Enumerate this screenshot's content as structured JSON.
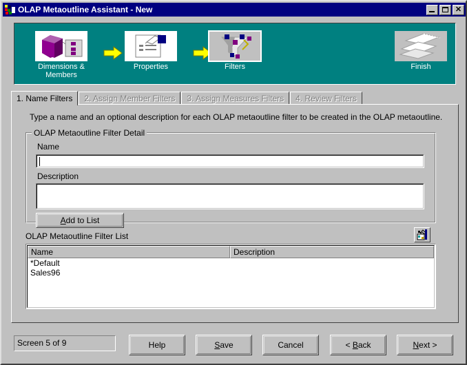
{
  "window": {
    "title": "OLAP Metaoutline Assistant - New",
    "icon": "olap-nodes-icon",
    "controls": [
      {
        "name": "minimize",
        "glyph": "_"
      },
      {
        "name": "maximize",
        "glyph": "□"
      },
      {
        "name": "close",
        "glyph": "✕"
      }
    ]
  },
  "banner": {
    "background_color": "#008080",
    "stages": [
      {
        "label": "Dimensions &\nMembers",
        "label_line1": "Dimensions &",
        "label_line2": "Members",
        "icon": "purple-cube-icon",
        "selected": false
      },
      {
        "label": "Properties",
        "label_line1": "Properties",
        "label_line2": "",
        "icon": "hand-writing-document-icon",
        "selected": false
      },
      {
        "label": "Filters",
        "label_line1": "Filters",
        "label_line2": "",
        "icon": "funnel-filter-icon",
        "selected": true
      },
      {
        "label": "Finish",
        "label_line1": "Finish",
        "label_line2": "",
        "icon": "finish-outline-icon",
        "selected": false
      }
    ],
    "arrows": [
      "arrow-right-icon",
      "arrow-right-icon"
    ],
    "arrow_color": "#ffff00"
  },
  "tabs": [
    {
      "label": "1. Name Filters",
      "active": true,
      "enabled": true
    },
    {
      "label": "2. Assign Member Filters",
      "active": false,
      "enabled": false
    },
    {
      "label": "3. Assign Measures Filters",
      "active": false,
      "enabled": false
    },
    {
      "label": "4. Review Filters",
      "active": false,
      "enabled": false
    }
  ],
  "page": {
    "instructions": "Type a name and an optional description for each OLAP metaoutline filter to be created in the OLAP metaoutline.",
    "detail_group": {
      "title": "OLAP Metaoutline Filter Detail",
      "name_label": "Name",
      "name_value": "",
      "name_placeholder": "",
      "description_label": "Description",
      "description_value": "",
      "description_placeholder": "",
      "add_button_label": "Add to List",
      "add_button_accel": "A"
    },
    "list_section": {
      "label": "OLAP Metaoutline Filter List",
      "delete_button": "delete-filter-icon",
      "columns": [
        "Name",
        "Description"
      ],
      "rows": [
        {
          "name": "*Default",
          "description": ""
        },
        {
          "name": "Sales96",
          "description": ""
        }
      ]
    }
  },
  "footer": {
    "status": "Screen 5 of 9",
    "buttons": [
      {
        "label": "Help",
        "accel": ""
      },
      {
        "label": "Save",
        "accel": "S"
      },
      {
        "label": "Cancel",
        "accel": ""
      },
      {
        "label": "< Back",
        "accel": "B"
      },
      {
        "label": "Next >",
        "accel": "N"
      }
    ]
  },
  "colors": {
    "face": "#c0c0c0",
    "titlebar": "#000080",
    "teal": "#008080",
    "disabled_text": "#808080",
    "accent_purple": "#800080",
    "accent_yellow": "#ffff00"
  }
}
